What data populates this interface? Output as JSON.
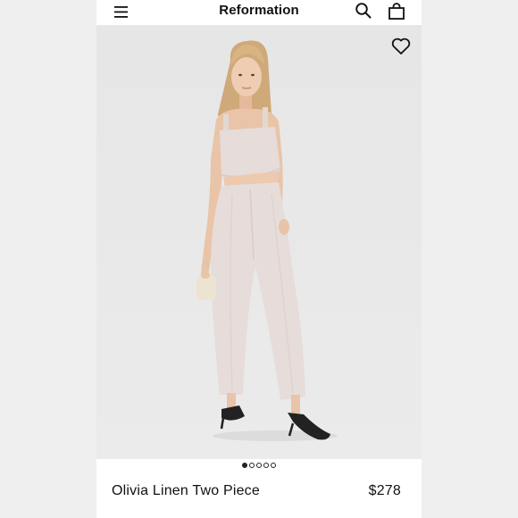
{
  "header": {
    "brand": "Reformation",
    "icons": {
      "menu": "hamburger-menu-icon",
      "search": "search-icon",
      "bag": "shopping-bag-icon"
    }
  },
  "hero": {
    "favorite_icon": "heart-outline-icon",
    "image_subject": "model-photo"
  },
  "carousel": {
    "count": 5,
    "active_index": 0
  },
  "product": {
    "name": "Olivia Linen Two Piece",
    "price": "$278"
  },
  "colors": {
    "background": "#efefef",
    "text": "#111111",
    "hero_backdrop": "#e8e8e8",
    "garment": "#e6dcd9",
    "skin": "#e9c4a8",
    "hair": "#cfa979"
  }
}
